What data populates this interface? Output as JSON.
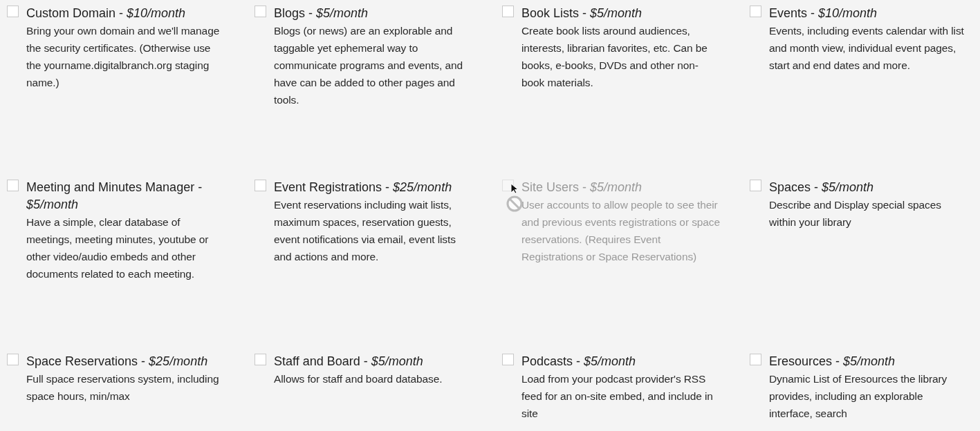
{
  "items": [
    {
      "title": "Custom Domain - *$10/month*",
      "description": "Bring your own domain and we'll manage the security certificates. (Otherwise use the yourname.digitalbranch.org staging name.)",
      "checked": false,
      "disabled": false,
      "hovered": false
    },
    {
      "title": "Blogs - *$5/month*",
      "description": "Blogs (or news) are an explorable and taggable yet ephemeral way to communicate programs and events, and have can be added to other pages and tools.",
      "checked": false,
      "disabled": false,
      "hovered": false
    },
    {
      "title": "Book Lists - *$5/month*",
      "description": "Create book lists around audiences, interests, librarian favorites, etc. Can be books, e-books, DVDs and other non-book materials.",
      "checked": false,
      "disabled": false,
      "hovered": false
    },
    {
      "title": "Events - *$10/month*",
      "description": "Events, including events calendar with list and month view, individual event pages, start and end dates and more.",
      "checked": false,
      "disabled": false,
      "hovered": false
    },
    {
      "title": "Meeting and Minutes Manager - *$5/month*",
      "description": "Have a simple, clear database of meetings, meeting minutes, youtube or other video/audio embeds and other documents related to each meeting.",
      "checked": false,
      "disabled": false,
      "hovered": false
    },
    {
      "title": "Event Registrations - *$25/month*",
      "description": "Event reservations including wait lists, maximum spaces, reservation guests, event notifications via email, event lists and actions and more.",
      "checked": false,
      "disabled": false,
      "hovered": false
    },
    {
      "title": "Site Users - *$5/month*",
      "description": "User accounts to allow people to see their and previous events registrations or space reservations. (Requires Event Registrations or Space Reservations)",
      "checked": false,
      "disabled": true,
      "hovered": true
    },
    {
      "title": "Spaces - *$5/month*",
      "description": "Describe and Display special spaces within your library",
      "checked": false,
      "disabled": false,
      "hovered": false
    },
    {
      "title": "Space Reservations - *$25/month*",
      "description": "Full space reservations system, including space hours, min/max",
      "checked": false,
      "disabled": false,
      "hovered": false
    },
    {
      "title": "Staff and Board - *$5/month*",
      "description": "Allows for staff and board database.",
      "checked": false,
      "disabled": false,
      "hovered": false
    },
    {
      "title": "Podcasts - *$5/month*",
      "description": "Load from your podcast provider's RSS feed for an on-site embed, and include in site",
      "checked": false,
      "disabled": false,
      "hovered": false
    },
    {
      "title": "Eresources - *$5/month*",
      "description": "Dynamic List of Eresources the library provides, including an explorable interface, search",
      "checked": false,
      "disabled": false,
      "hovered": false
    }
  ]
}
